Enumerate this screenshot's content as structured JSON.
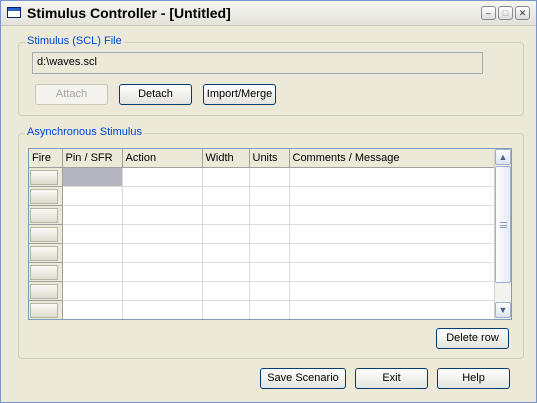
{
  "window": {
    "title": "Stimulus Controller - [Untitled]",
    "controls": {
      "minimize": "–",
      "maximize": "□",
      "close": "✕"
    }
  },
  "scl_file": {
    "group_label": "Stimulus (SCL)  File",
    "path": "d:\\waves.scl",
    "attach_label": "Attach",
    "detach_label": "Detach",
    "import_merge_label": "Import/Merge"
  },
  "async_stimulus": {
    "group_label": "Asynchronous Stimulus",
    "columns": [
      "Fire",
      "Pin / SFR",
      "Action",
      "Width",
      "Units",
      "Comments / Message"
    ],
    "row_count": 8,
    "delete_row_label": "Delete row"
  },
  "footer": {
    "save_scenario_label": "Save Scenario",
    "exit_label": "Exit",
    "help_label": "Help"
  },
  "scrollbar": {
    "up": "▲",
    "down": "▼"
  }
}
